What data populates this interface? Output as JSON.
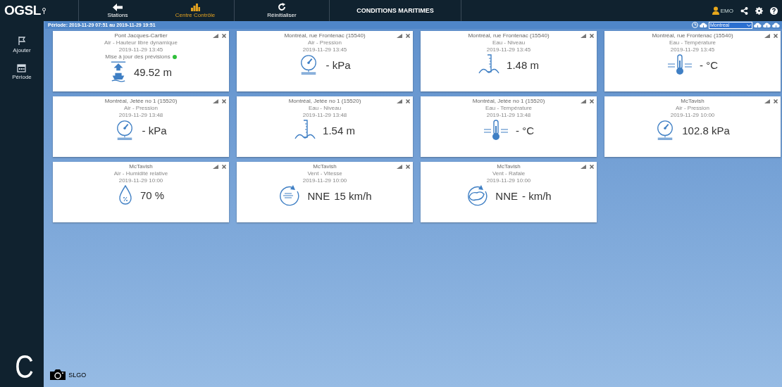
{
  "topbar": {
    "logo": "OGSL",
    "nav": [
      {
        "label": "Stations",
        "kind": "arrow",
        "selected": false
      },
      {
        "label": "Centre Contrôle",
        "kind": "bars",
        "selected": true
      },
      {
        "label": "Réinitialiser",
        "kind": "refresh",
        "selected": false
      }
    ],
    "title": "CONDITIONS MARITIMES",
    "user": "EMO"
  },
  "sidebar": {
    "items": [
      {
        "label": "Ajouter",
        "kind": "flag"
      },
      {
        "label": "Période",
        "kind": "calendar"
      }
    ]
  },
  "period_bar": {
    "text": "Période: 2019-11-29 07:51 au 2019-11-29 19:51",
    "region": "Montreal"
  },
  "cards": [
    {
      "station": "Pont Jacques-Cartier",
      "parameter": "Air - Hauteur libre dynamique",
      "time": "2019-11-29 13:45",
      "status": "Mise à jour des prévisions",
      "color": "#2fbf3a",
      "kind": "boat",
      "value": "49.52 m"
    },
    {
      "station": "Montréal, rue Frontenac (15540)",
      "parameter": "Air - Pression",
      "time": "2019-11-29 13:45",
      "kind": "gauge",
      "value": "- kPa"
    },
    {
      "station": "Montréal, rue Frontenac (15540)",
      "parameter": "Eau - Niveau",
      "time": "2019-11-29 13:45",
      "kind": "level",
      "value": "1.48 m"
    },
    {
      "station": "Montréal, rue Frontenac (15540)",
      "parameter": "Eau - Température",
      "time": "2019-11-29 13:45",
      "kind": "thermo",
      "value": "- °C"
    },
    {
      "station": "Montréal, Jetée no 1 (15520)",
      "parameter": "Air - Pression",
      "time": "2019-11-29 13:48",
      "kind": "gauge",
      "value": "- kPa"
    },
    {
      "station": "Montréal, Jetée no 1 (15520)",
      "parameter": "Eau - Niveau",
      "time": "2019-11-29 13:48",
      "kind": "level",
      "value": "1.54 m"
    },
    {
      "station": "Montréal, Jetée no 1 (15520)",
      "parameter": "Eau - Température",
      "time": "2019-11-29 13:48",
      "kind": "thermo",
      "value": "- °C"
    },
    {
      "station": "McTavish",
      "parameter": "Air - Pression",
      "time": "2019-11-29 10:00",
      "kind": "gauge",
      "value": "102.8 kPa"
    },
    {
      "station": "McTavish",
      "parameter": "Air - Humidité relative",
      "time": "2019-11-29 10:00",
      "kind": "drop",
      "value": "70 %"
    },
    {
      "station": "McTavish",
      "parameter": "Vent - Vitesse",
      "time": "2019-11-29 10:00",
      "kind": "wind",
      "direction": "NNE",
      "value": "15 km/h"
    },
    {
      "station": "McTavish",
      "parameter": "Vent - Rafale",
      "time": "2019-11-29 10:00",
      "kind": "gust",
      "direction": "NNE",
      "value": "- km/h"
    }
  ],
  "panel_label": "C",
  "credit": "SLGO"
}
